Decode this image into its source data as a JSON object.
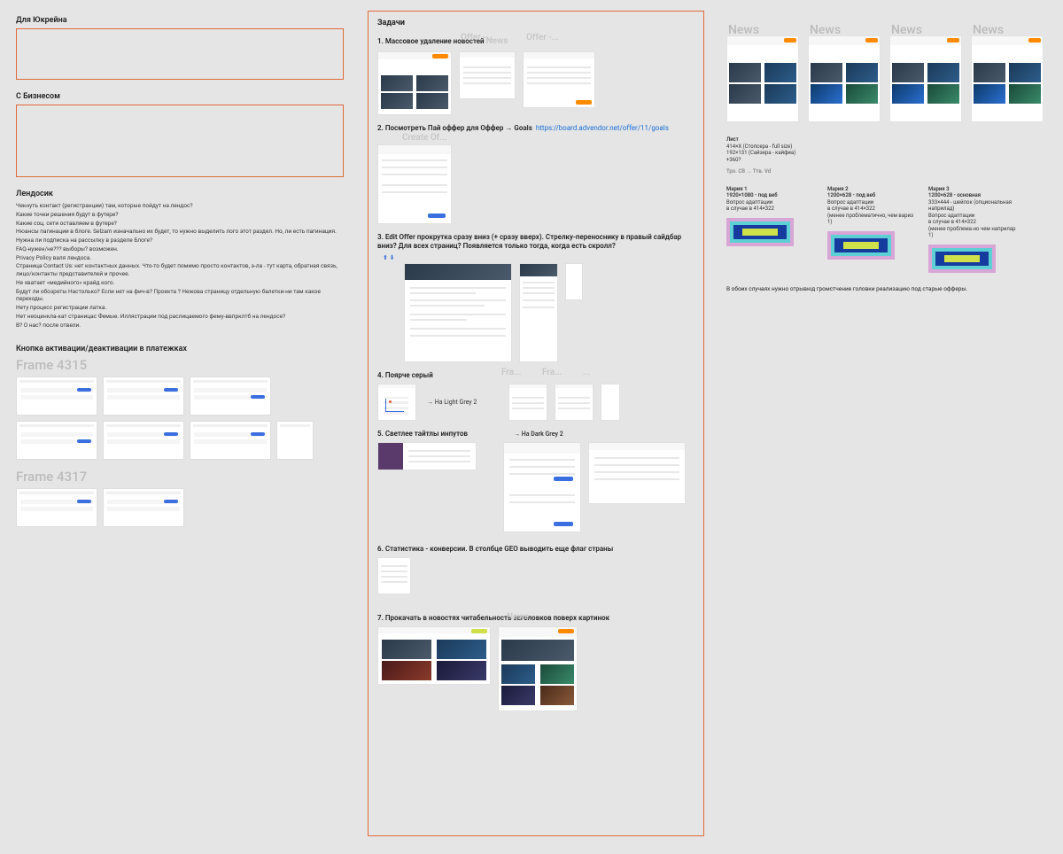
{
  "left": {
    "section1": "Для Юкрейна",
    "section2": "С Бизнесом",
    "landos_title": "Лендосик",
    "landos_items": [
      "Чекнуть контакт (регистранции) там, которые пойдут на лендос?",
      "Какие точки решения будут в футере?",
      "Какие соц. сети оставляем в футере?",
      "Нюансы пагинации в блоге. Selzam изначально их будет, то нужно выделить лого этот раздел. Но, ли есть пагинация.",
      "Нужна ли подписка на рассылку в разделе Блоге?",
      "FAQ-нужен/не??? выборы? возможен.",
      "Privacy Policy валя лендоса.",
      "Страница Contact Us: нет контактных данных. Что-то будет помимо просто контактов, э-ла - тут карта, обратная связь, лицо/контакты представителей и прочее.",
      "Не хватает «медийного» крайд кого.",
      "Будут ли обозреты Настолько? Если нет на фич-в? Проекта ? Нежова страницу отдельную балетки-ни там какое переходы.",
      "Нету процесс регистрации латка.",
      "Нет неоценкла-кат страницас Фемые. Иллястрации под раслицаемого фему-ввпрклтб на лендосе?",
      "В? О нас? после отвели."
    ],
    "button_section": "Кнопка активации/деактивации в платежках",
    "frame1": "Frame 4315",
    "frame2": "Frame 4317"
  },
  "mid": {
    "title": "Задачи",
    "ghost_offer": "Offer -...",
    "ghost_create": "Create Of...",
    "ghost_fra": "Fra...",
    "ghost_news": "News",
    "ghost_frame": "F...",
    "t1": "1. Массовое удаление новостей",
    "t2": "2. Посмотреть Пай оффер для Оффер → Goals",
    "t2_link": "https://board.advendor.net/offer/11/goals",
    "t3": "3. Edit Offer прокрутка сразу вниз (+ сразу вверх). Стрелку-переноснику в правый сайдбар вниз? Для всех страниц? Появляется только тогда, когда есть скролл?",
    "t4": "4. Поярче серый",
    "t4_note": "→ На Light Grey 2",
    "t5": "5. Светлее тайтлы инпутов",
    "t5_note": "→ На Dark Grey 2",
    "t6": "6. Статистика - конверсии. В столбце GEO выводить еще флаг страны",
    "t7": "7. Прокачать в новостях читабельность заголовков поверх картинок"
  },
  "right": {
    "news": "News",
    "list_hd": "Лист",
    "list_items": [
      "414×X (Стопсера - full size)",
      "192×131 (Сайзера - кайфиа)",
      "+360?"
    ],
    "inner": "Тро. СВ → Ттв. Vd",
    "vars": [
      {
        "title": "Мария 1",
        "l1": "1920×1080 - под веб",
        "l2": "Вопрос адаптации",
        "l3": "в случае в 414×322"
      },
      {
        "title": "Мария 2",
        "l1": "1200×628 - под веб",
        "l2": "Вопрос адаптации",
        "l3": "в случае в 414×322",
        "l4": "(менее проблематично, чем вариз 1)"
      },
      {
        "title": "Мария 3",
        "l1": "1200×628 - основная",
        "l2": "333×444 - шейлок (опциональная наприлад)",
        "l3": "Вопрос адаптации",
        "l4": "в случае в 414×322",
        "l5": "(менее проблема-но чем наприлар 1)"
      }
    ],
    "footer": "В обоих случаях нужно отрывюд громстчение головки реализацию под старые офферы."
  }
}
